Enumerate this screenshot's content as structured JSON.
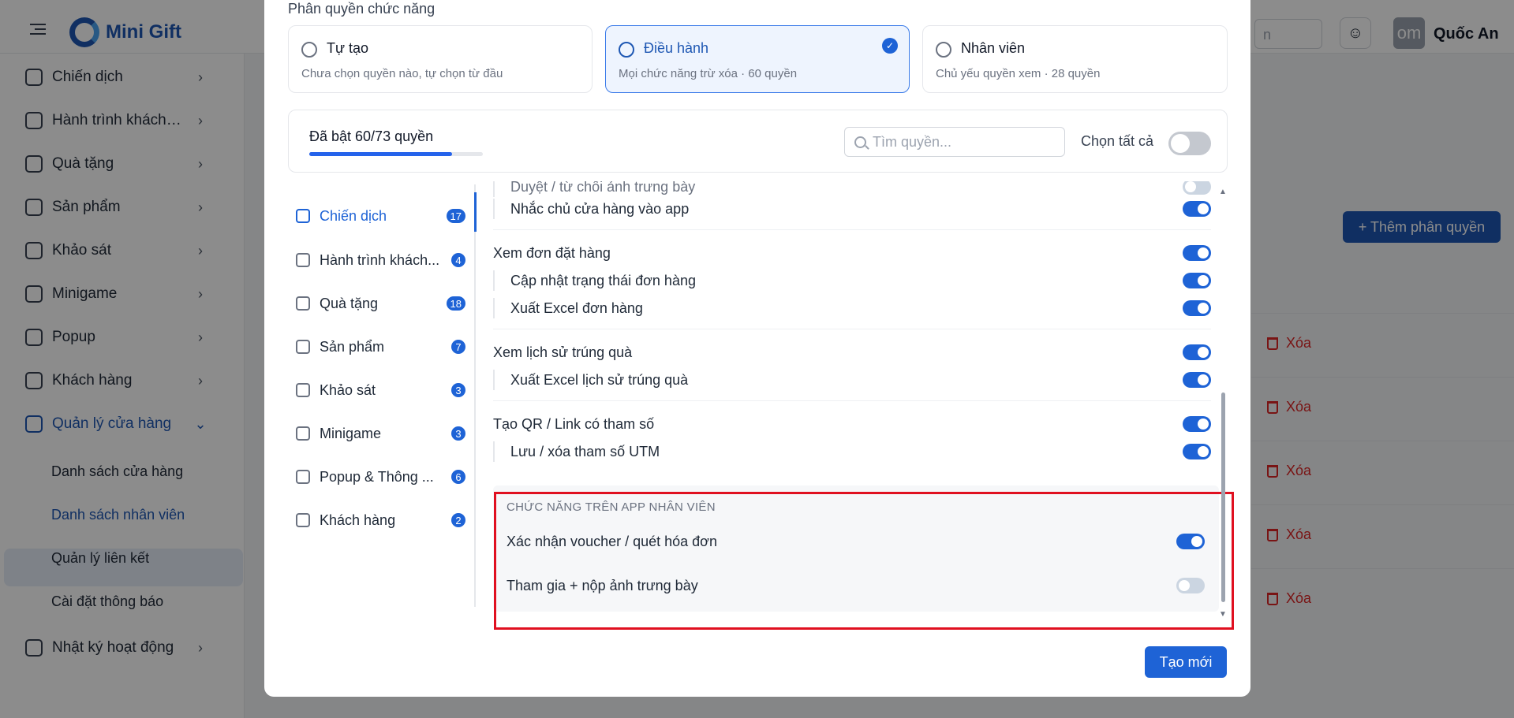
{
  "app": {
    "logo_text": "Mini Gift",
    "search_placeholder": "n",
    "user_initials": "om",
    "user_name": "Quốc An"
  },
  "sidebar": {
    "items": [
      {
        "label": "Chiến dịch",
        "icon": "calendar-icon"
      },
      {
        "label": "Hành trình khách hà...",
        "icon": "route-icon"
      },
      {
        "label": "Quà tặng",
        "icon": "gift-icon"
      },
      {
        "label": "Sản phẩm",
        "icon": "box-icon"
      },
      {
        "label": "Khảo sát",
        "icon": "survey-icon"
      },
      {
        "label": "Minigame",
        "icon": "gamepad-icon"
      },
      {
        "label": "Popup",
        "icon": "popup-icon"
      },
      {
        "label": "Khách hàng",
        "icon": "users-icon"
      },
      {
        "label": "Quản lý cửa hàng",
        "icon": "store-icon"
      },
      {
        "label": "Nhật ký hoạt động",
        "icon": "log-icon"
      }
    ],
    "sub_items": [
      "Danh sách cửa hàng",
      "Danh sách nhân viên",
      "Quản lý liên kết",
      "Cài đặt thông báo"
    ]
  },
  "main": {
    "add_button": "+ Thêm phân quyền",
    "delete_label": "Xóa"
  },
  "modal": {
    "section_title": "Phân quyền chức năng",
    "roles": [
      {
        "title": "Tự tạo",
        "desc": "Chưa chọn quyền nào, tự chọn từ đầu",
        "selected": false,
        "icon": "pencil-icon"
      },
      {
        "title": "Điều hành",
        "desc": "Mọi chức năng trừ xóa · 60 quyền",
        "selected": true,
        "icon": "user-shield-icon"
      },
      {
        "title": "Nhân viên",
        "desc": "Chủ yếu quyền xem · 28 quyền",
        "selected": false,
        "icon": "team-icon"
      }
    ],
    "summary": {
      "count_text": "Đã bật 60/73 quyền",
      "progress_fraction": 0.822,
      "search_placeholder": "Tìm quyền...",
      "select_all_label": "Chọn tất cả",
      "select_all_on": false
    },
    "categories": [
      {
        "label": "Chiến dịch",
        "count": "17",
        "active": true
      },
      {
        "label": "Hành trình khách...",
        "count": "4"
      },
      {
        "label": "Quà tặng",
        "count": "18"
      },
      {
        "label": "Sản phẩm",
        "count": "7"
      },
      {
        "label": "Khảo sát",
        "count": "3"
      },
      {
        "label": "Minigame",
        "count": "3"
      },
      {
        "label": "Popup & Thông ...",
        "count": "6"
      },
      {
        "label": "Khách hàng",
        "count": "2"
      }
    ],
    "permissions": [
      {
        "label": "Duyệt / từ chối ảnh trưng bày",
        "child": true,
        "on": false
      },
      {
        "label": "Nhắc chủ cửa hàng vào app",
        "child": true,
        "on": true
      },
      {
        "label": "Xem đơn đặt hàng",
        "child": false,
        "on": true
      },
      {
        "label": "Cập nhật trạng thái đơn hàng",
        "child": true,
        "on": true
      },
      {
        "label": "Xuất Excel đơn hàng",
        "child": true,
        "on": true
      },
      {
        "label": "Xem lịch sử trúng quà",
        "child": false,
        "on": true
      },
      {
        "label": "Xuất Excel lịch sử trúng quà",
        "child": true,
        "on": true
      },
      {
        "label": "Tạo QR / Link có tham số",
        "child": false,
        "on": true
      },
      {
        "label": "Lưu / xóa tham số UTM",
        "child": true,
        "on": true
      }
    ],
    "app_section": {
      "title": "CHỨC NĂNG TRÊN APP NHÂN VIÊN",
      "items": [
        {
          "label": "Xác nhận voucher / quét hóa đơn",
          "on": true
        },
        {
          "label": "Tham gia + nộp ảnh trưng bày",
          "on": false
        }
      ]
    },
    "create_button": "Tạo mới"
  },
  "colors": {
    "primary": "#1e63d6",
    "brand": "#1e57b3",
    "danger": "#dc2626",
    "highlight_frame": "#e01020"
  }
}
